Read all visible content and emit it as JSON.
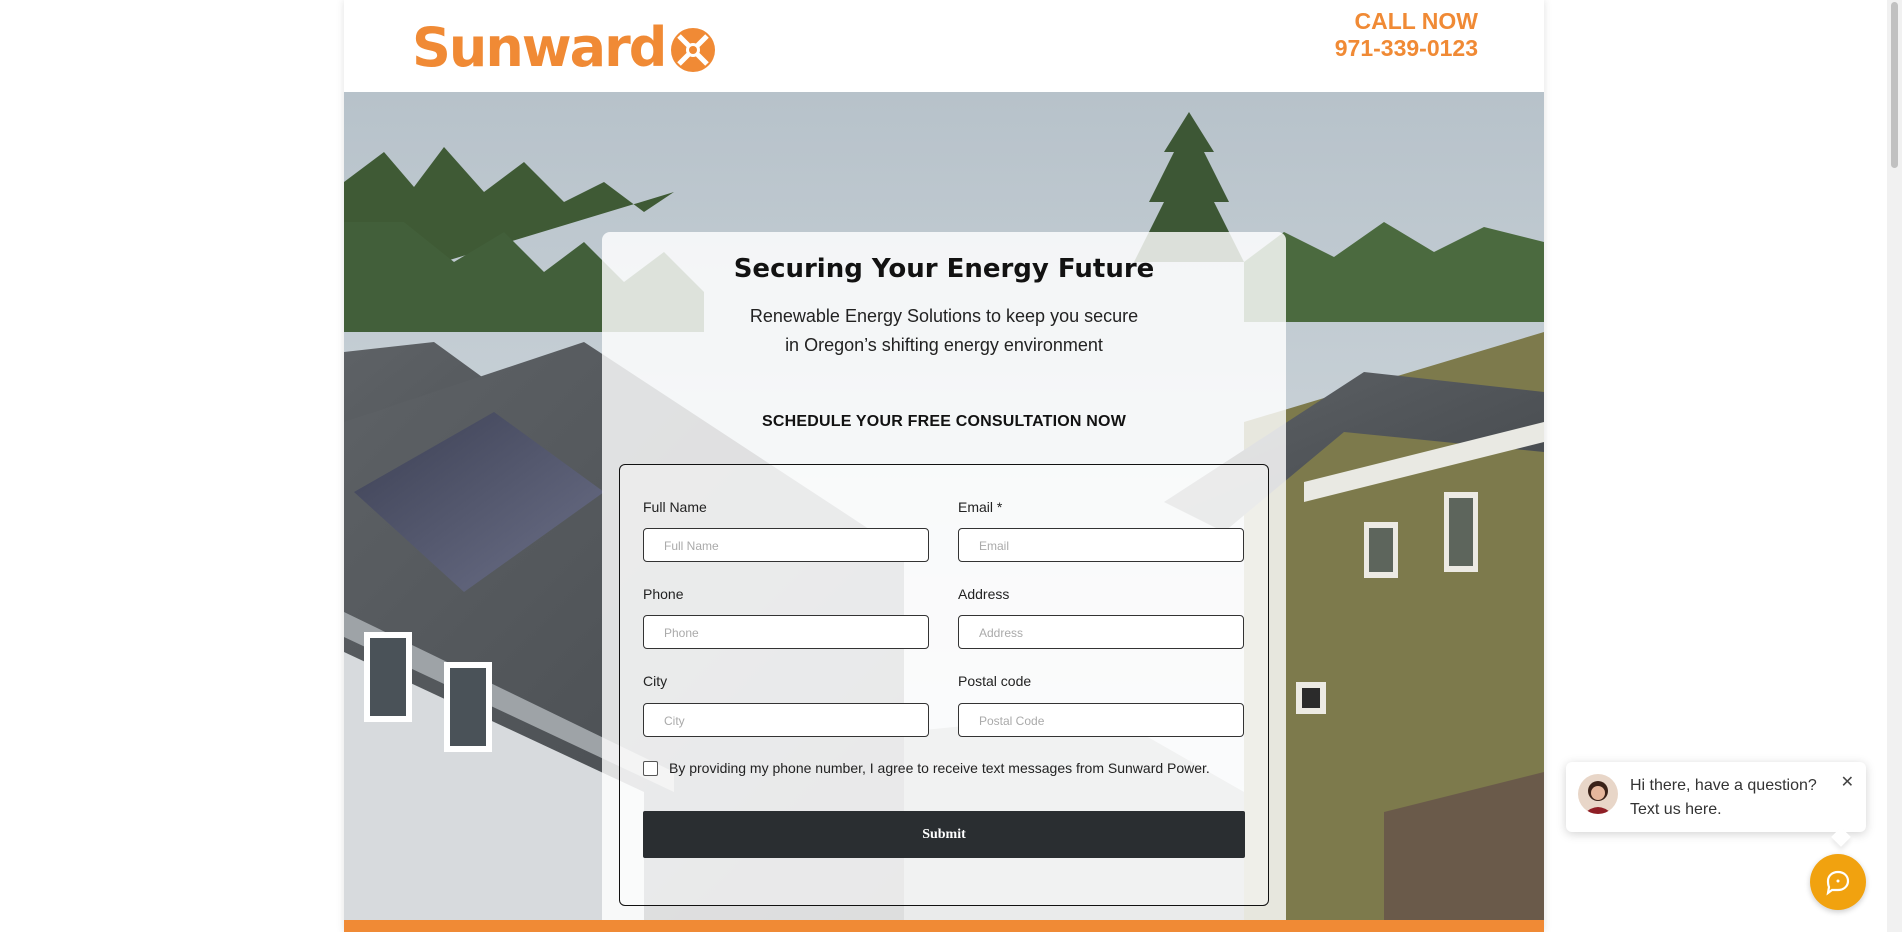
{
  "brand": {
    "name": "Sunward",
    "accent_color": "#f08a35"
  },
  "header": {
    "call_label": "CALL NOW",
    "phone": "971-339-0123"
  },
  "hero": {
    "title": "Securing Your Energy Future",
    "subtitle_line1": "Renewable Energy Solutions to keep you secure",
    "subtitle_line2": "in Oregon’s shifting energy environment",
    "schedule_heading": "SCHEDULE YOUR FREE CONSULTATION NOW"
  },
  "form": {
    "full_name": {
      "label": "Full Name",
      "placeholder": "Full Name"
    },
    "email": {
      "label": "Email *",
      "placeholder": "Email"
    },
    "phone": {
      "label": "Phone",
      "placeholder": "Phone"
    },
    "address": {
      "label": "Address",
      "placeholder": "Address"
    },
    "city": {
      "label": "City",
      "placeholder": "City"
    },
    "postal": {
      "label": "Postal code",
      "placeholder": "Postal Code"
    },
    "consent": "By providing my phone number, I agree to receive text messages from Sunward Power.",
    "submit": "Submit"
  },
  "chat": {
    "line1": "Hi there, have a question?",
    "line2": "Text us here.",
    "close_icon": "close-icon",
    "fab_icon": "chat-icon",
    "fab_color": "#f1a20f"
  }
}
